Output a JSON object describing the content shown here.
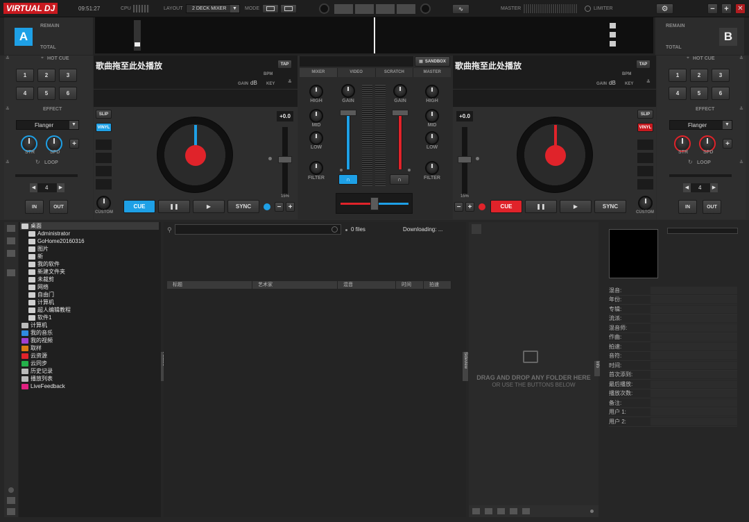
{
  "topbar": {
    "logo": "VIRTUAL DJ",
    "clock": "09:51:27",
    "cpu_label": "CPU",
    "layout_label": "LAYOUT",
    "layout_value": "2 DECK MIXER",
    "mode_label": "MODE",
    "master_label": "MASTER",
    "limiter_label": "LIMITER"
  },
  "deck_a": {
    "letter": "A",
    "remain": "REMAIN",
    "total": "TOTAL",
    "title": "歌曲拖至此处播放",
    "tap": "TAP",
    "bpm": "BPM",
    "gain": "GAIN",
    "db": "dB",
    "key": "KEY",
    "slip": "SLIP",
    "vinyl": "VINYL",
    "pitch": "+0.0",
    "pitch_range": "15%",
    "cue": "CUE",
    "sync": "SYNC",
    "custom": "CUSTOM",
    "hotcue_label": "HOT CUE",
    "hotcues": [
      "1",
      "2",
      "3",
      "4",
      "5",
      "6"
    ],
    "effect_label": "EFFECT",
    "effect_value": "Flanger",
    "str": "STR",
    "spd": "SPD",
    "loop_label": "LOOP",
    "loop_value": "4",
    "in": "IN",
    "out": "OUT",
    "accent": "#1ea0e6"
  },
  "deck_b": {
    "letter": "B",
    "remain": "REMAIN",
    "total": "TOTAL",
    "title": "歌曲拖至此处播放",
    "tap": "TAP",
    "bpm": "BPM",
    "gain": "GAIN",
    "db": "dB",
    "key": "KEY",
    "slip": "SLIP",
    "vinyl": "VINYL",
    "pitch": "+0.0",
    "pitch_range": "15%",
    "cue": "CUE",
    "sync": "SYNC",
    "custom": "CUSTOM",
    "hotcue_label": "HOT CUE",
    "hotcues": [
      "1",
      "2",
      "3",
      "4",
      "5",
      "6"
    ],
    "effect_label": "EFFECT",
    "effect_value": "Flanger",
    "str": "STR",
    "spd": "SPD",
    "loop_label": "LOOP",
    "loop_value": "4",
    "in": "IN",
    "out": "OUT",
    "accent": "#e0232a"
  },
  "mixer": {
    "sandbox": "SANDBOX",
    "tabs": [
      "MIXER",
      "VIDEO",
      "SCRATCH",
      "MASTER"
    ],
    "high": "HIGH",
    "mid": "MID",
    "low": "LOW",
    "filter": "FILTER",
    "gain": "GAIN"
  },
  "browser": {
    "tree": [
      {
        "label": "桌面",
        "indent": 0,
        "icon": "folder"
      },
      {
        "label": "Administrator",
        "indent": 1,
        "icon": "folder"
      },
      {
        "label": "GoHome20160316",
        "indent": 1,
        "icon": "folder"
      },
      {
        "label": "图片",
        "indent": 1,
        "icon": "folder"
      },
      {
        "label": "新",
        "indent": 1,
        "icon": "folder"
      },
      {
        "label": "我的软件",
        "indent": 1,
        "icon": "folder"
      },
      {
        "label": "新建文件夹",
        "indent": 1,
        "icon": "folder"
      },
      {
        "label": "未裁剪",
        "indent": 1,
        "icon": "folder"
      },
      {
        "label": "网络",
        "indent": 1,
        "icon": "folder"
      },
      {
        "label": "自由门",
        "indent": 1,
        "icon": "folder"
      },
      {
        "label": "计算机",
        "indent": 1,
        "icon": "folder"
      },
      {
        "label": "超人编辑教程",
        "indent": 1,
        "icon": "folder"
      },
      {
        "label": "软件1",
        "indent": 1,
        "icon": "folder"
      },
      {
        "label": "计算机",
        "indent": 0,
        "icon": "computer"
      },
      {
        "label": "我的音乐",
        "indent": 0,
        "icon": "music"
      },
      {
        "label": "我的视频",
        "indent": 0,
        "icon": "video"
      },
      {
        "label": "取样",
        "indent": 0,
        "icon": "sample"
      },
      {
        "label": "云资源",
        "indent": 0,
        "icon": "cloud"
      },
      {
        "label": "云同步",
        "indent": 0,
        "icon": "sync"
      },
      {
        "label": "历史记录",
        "indent": 0,
        "icon": "history"
      },
      {
        "label": "播放列表",
        "indent": 0,
        "icon": "playlist"
      },
      {
        "label": "LiveFeedback",
        "indent": 0,
        "icon": "live"
      }
    ],
    "files_count": "0 files",
    "downloading": "Downloading: ...",
    "columns": [
      "标题",
      "艺术家",
      "混音",
      "时间",
      "拍速"
    ],
    "folders_tab": "Folders",
    "sideview_tab": "Sideview",
    "info_tab": "Info",
    "drop_line1": "DRAG AND DROP ANY FOLDER HERE",
    "drop_line2": "OR USE THE BUTTONS BELOW"
  },
  "info": {
    "fields": [
      "混音:",
      "年份:",
      "专辑:",
      "流派:",
      "混音师:",
      "作曲:",
      "拍速:",
      "音符:",
      "时间:",
      "首次添到:",
      "最后播放:",
      "播放次数:",
      "备注:",
      "用户 1:",
      "用户 2:"
    ]
  }
}
